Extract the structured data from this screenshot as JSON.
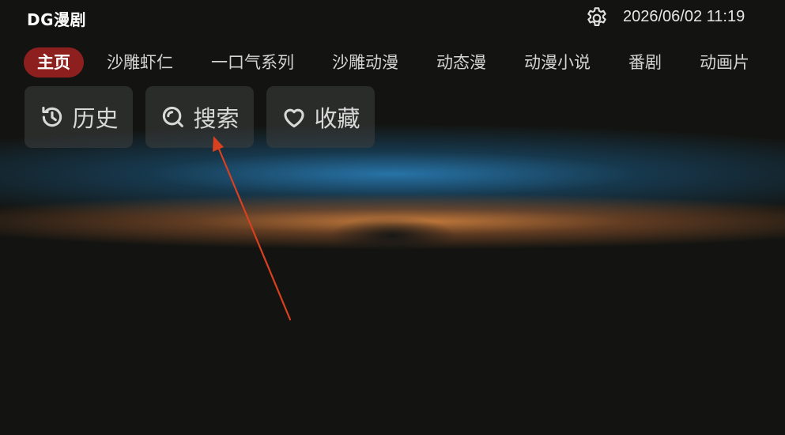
{
  "app": {
    "title": "DG漫剧"
  },
  "status_bar": {
    "datetime": "2026/06/02 11:19",
    "settings_icon": "gear-icon"
  },
  "tabs": [
    {
      "label": "主页",
      "active": true
    },
    {
      "label": "沙雕虾仁",
      "active": false
    },
    {
      "label": "一口气系列",
      "active": false
    },
    {
      "label": "沙雕动漫",
      "active": false
    },
    {
      "label": "动态漫",
      "active": false
    },
    {
      "label": "动漫小说",
      "active": false
    },
    {
      "label": "番剧",
      "active": false
    },
    {
      "label": "动画片",
      "active": false
    }
  ],
  "quick_actions": [
    {
      "label": "历史",
      "icon": "history-icon"
    },
    {
      "label": "搜索",
      "icon": "search-icon"
    },
    {
      "label": "收藏",
      "icon": "heart-icon"
    }
  ],
  "colors": {
    "background": "#131411",
    "active_tab": "#8e1f1f",
    "annotation_arrow": "#d9401f"
  }
}
